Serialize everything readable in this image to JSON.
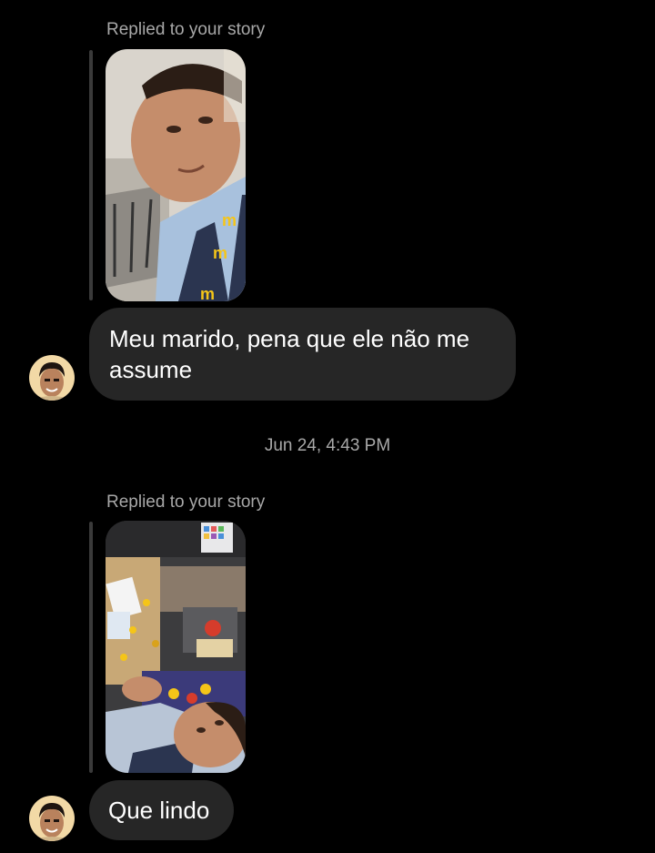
{
  "thread": {
    "messages": [
      {
        "reply_label": "Replied to your story",
        "text": "Meu marido, pena que ele não me assume"
      },
      {
        "reply_label": "Replied to your story",
        "text": "Que lindo"
      }
    ],
    "timestamp": "Jun 24, 4:43 PM"
  },
  "colors": {
    "background": "#000000",
    "bubble": "#262626",
    "secondary_text": "#a8a8a8",
    "reply_rule": "#3a3a3a"
  }
}
